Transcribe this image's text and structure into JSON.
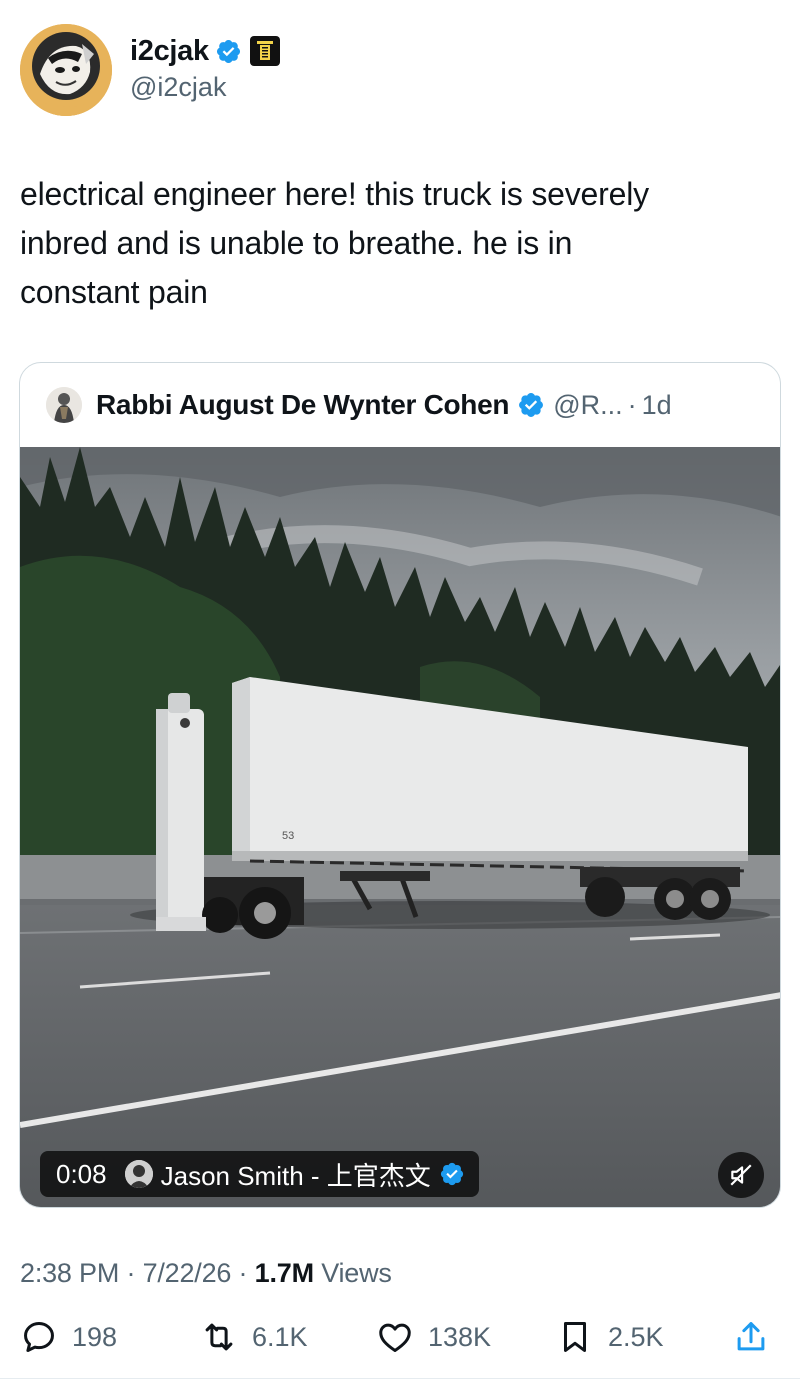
{
  "author": {
    "display_name": "i2cjak",
    "handle": "@i2cjak",
    "avatar_badge_text": "#OPENTOSAUCE"
  },
  "tweet": {
    "lines": [
      "electrical engineer here! this truck is severely",
      "inbred and is unable to breathe. he is in",
      "constant pain"
    ]
  },
  "quote": {
    "display_name": "Rabbi August De Wynter Cohen",
    "handle": "@R...",
    "separator": "·",
    "time": "1d",
    "video": {
      "duration": "0:08",
      "credit": "Jason Smith - 上官杰文",
      "trailer_number": "53"
    }
  },
  "meta": {
    "time": "2:38 PM",
    "sep1": " · ",
    "date": "7/22/26",
    "sep2": " · ",
    "views_count": "1.7M",
    "views_label": " Views"
  },
  "actions": {
    "replies": "198",
    "reposts": "6.1K",
    "likes": "138K",
    "bookmarks": "2.5K"
  },
  "colors": {
    "verified": "#1d9bf0",
    "text_primary": "#0f1419",
    "text_secondary": "#536471",
    "border": "#cfd9de"
  }
}
